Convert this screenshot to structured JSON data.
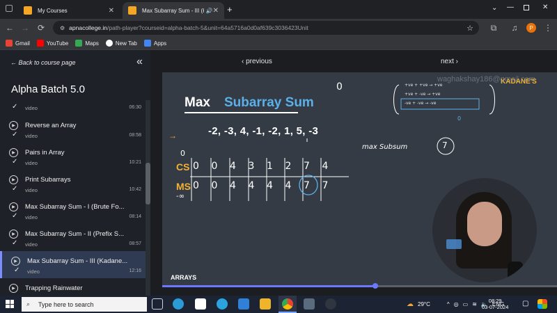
{
  "browser": {
    "tabs": [
      {
        "title": "My Courses",
        "active": false
      },
      {
        "title": "Max Subarray Sum - III (Kad…",
        "active": true
      }
    ],
    "new_tab_symbol": "+",
    "url_host": "apnacollege.in",
    "url_path": "/path-player?courseid=alpha-batch-5&unit=64a5716a0d0af639c3036423Unit",
    "profile_initial": "P",
    "bookmarks": [
      {
        "label": "Gmail",
        "color": "#ea4335"
      },
      {
        "label": "YouTube",
        "color": "#ff0000"
      },
      {
        "label": "Maps",
        "color": "#34a853"
      },
      {
        "label": "New Tab",
        "color": "#ffffff"
      },
      {
        "label": "Apps",
        "color": "#4285f4"
      }
    ]
  },
  "sidebar": {
    "back_label": "← Back to course page",
    "course_title": "Alpha Batch 5.0",
    "lessons": [
      {
        "title": "",
        "type": "video",
        "duration": "06:30",
        "done": true,
        "active": false
      },
      {
        "title": "Reverse an Array",
        "type": "video",
        "duration": "08:58",
        "done": true,
        "active": false
      },
      {
        "title": "Pairs in Array",
        "type": "video",
        "duration": "10:21",
        "done": true,
        "active": false
      },
      {
        "title": "Print Subarrays",
        "type": "video",
        "duration": "10:42",
        "done": true,
        "active": false
      },
      {
        "title": "Max Subarray Sum - I (Brute Fo...",
        "type": "video",
        "duration": "08:14",
        "done": true,
        "active": false
      },
      {
        "title": "Max Subarray Sum - II (Prefix S...",
        "type": "video",
        "duration": "08:57",
        "done": true,
        "active": false
      },
      {
        "title": "Max Subarray Sum - III (Kadane...",
        "type": "video",
        "duration": "12:16",
        "done": true,
        "active": true
      },
      {
        "title": "Trapping Rainwater",
        "type": "video",
        "duration": "",
        "done": false,
        "active": false
      }
    ]
  },
  "player": {
    "previous_label": "‹ previous",
    "next_label": "next ›",
    "progress_fraction": 0.54,
    "slide": {
      "title_white": "Max",
      "title_blue": "Subarray Sum",
      "array_text": "-2, -3, 4, -1, -2, 1, 5, -3",
      "cs_label": "CS",
      "ms_label": "MS",
      "cs_values": [
        "0",
        "0",
        "4",
        "3",
        "1",
        "2",
        "7",
        "4"
      ],
      "ms_values": [
        "0",
        "0",
        "4",
        "4",
        "4",
        "4",
        "7",
        "7"
      ],
      "ms_init": "-∞",
      "zero_top": "0",
      "zero_right": "0",
      "maxsub_note": "max Subsum",
      "maxsub_value": "7",
      "kadane_label": "KADANE'S",
      "watermark": "waghakshay186@gmail.com",
      "caption": "ARRAYS",
      "note_lines": [
        "+ve + +ve → +ve",
        "+ve + -ve → +ve",
        "-ve + -ve → -ve"
      ],
      "note_zero": "0"
    }
  },
  "taskbar": {
    "search_placeholder": "Type here to search",
    "weather": "29°C",
    "language": "ENG",
    "time": "08:29",
    "date": "03-07-2024"
  }
}
